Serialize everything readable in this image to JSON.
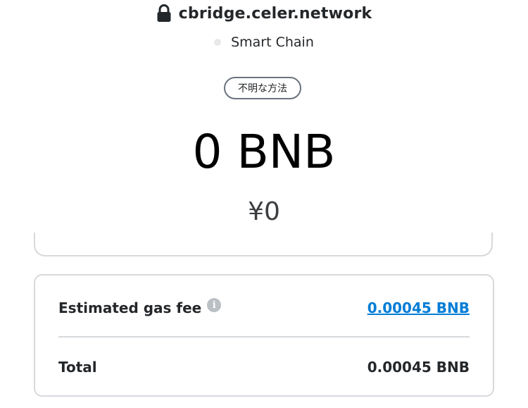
{
  "header": {
    "lock_icon": "lock-icon",
    "origin": "cbridge.celer.network",
    "network_label": "Smart Chain",
    "network_dot_color": "#e8e8ea"
  },
  "method_pill": {
    "label": "不明な方法"
  },
  "amount": {
    "value": "0 BNB",
    "fiat": "¥0"
  },
  "fees": {
    "gas_label": "Estimated gas fee",
    "info_icon": "info-icon",
    "gas_value": "0.00045 BNB",
    "total_label": "Total",
    "total_value": "0.00045 BNB",
    "link_color": "#037dd6"
  }
}
